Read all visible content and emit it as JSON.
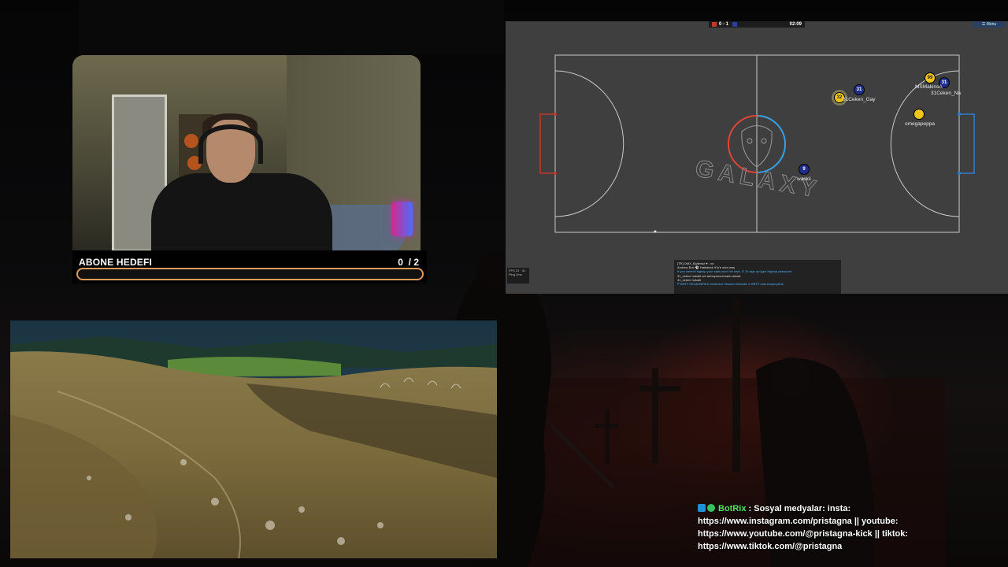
{
  "goal": {
    "title": "ABONE HEDEFI",
    "current": "0",
    "target": "/ 2",
    "progress": 0
  },
  "game": {
    "score": "0 - 1",
    "timer": "02:09",
    "menu_label": "☰ Menu",
    "players": [
      {
        "number": "31",
        "name": "31Ceken_Gay",
        "team": "blue"
      },
      {
        "number": "32",
        "name": "31Ceken_Gay",
        "team": "yellow"
      },
      {
        "number": "99",
        "name": "MSMakinsA",
        "team": "yellow"
      },
      {
        "number": "31",
        "name": "31Ceken_Na",
        "team": "blue"
      },
      {
        "number": "",
        "name": "omegapeppa",
        "team": "yellow"
      },
      {
        "number": "9",
        "name": "wackii",
        "team": "blue"
      }
    ],
    "field_logo": "GALAXY",
    "fps": [
      "FPS 22 · 41",
      "Ping 2ms"
    ],
    "chat_lines": [
      "[TR] OMX_Ballerski ♥ : xd",
      "Andrew Bot: ⚽ Hattatrick 9'lu'e shot was",
      "If you weren't signup your stats won't be kept. ⊙ To sign up type !signup password",
      "31_ceken hubalti set anheyonora kadu aimak",
      "31_ceken hubalti",
      "⁉ BRFT HEADHERED mostheur hesuum kiomalk ⊙ BRFT mac basye pbhe"
    ]
  },
  "bot_message": {
    "name": "BotRix",
    "text": ": Sosyal medyalar: insta: https://www.instagram.com/pristagna || youtube: https://www.youtube.com/@pristagna-kick || tiktok: https://www.tiktok.com/@pristagna"
  },
  "colors": {
    "goal_border": "#e29a5a",
    "field_bg": "#3f3f3f",
    "red_team": "#c0392b",
    "blue_team": "#1f2e8a",
    "bot_name": "#55e55c"
  }
}
